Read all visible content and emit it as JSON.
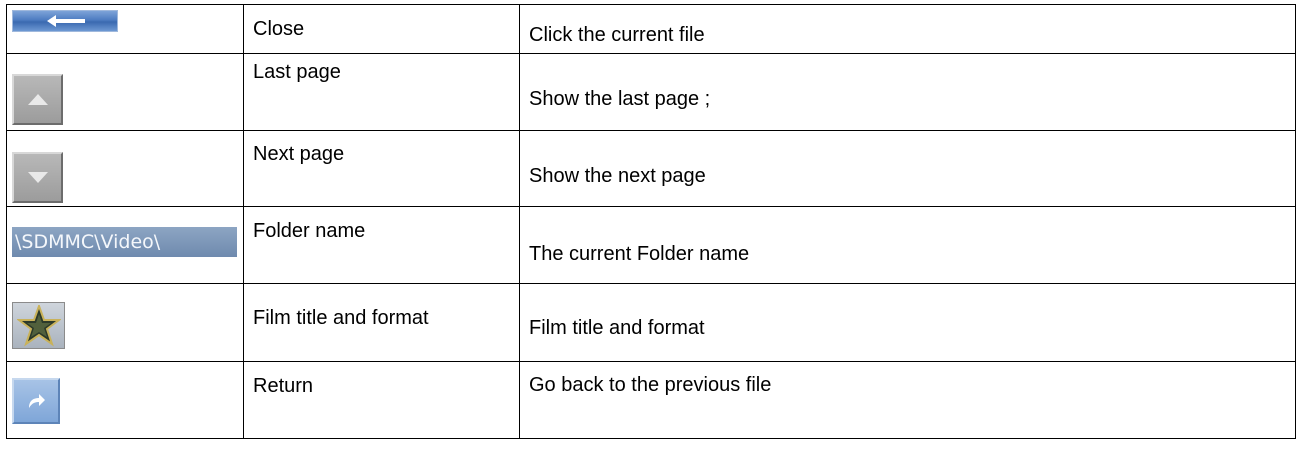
{
  "rows": [
    {
      "icon": "back-arrow-button-icon",
      "name": "Close",
      "description": "Click the current file"
    },
    {
      "icon": "up-arrow-button-icon",
      "name": "Last page",
      "description": "Show the last page ;"
    },
    {
      "icon": "down-arrow-button-icon",
      "name": "Next page",
      "description": "Show the next page"
    },
    {
      "icon": "folder-path-bar",
      "folder_path": "\\SDMMC\\Video\\",
      "name": "Folder name",
      "description": "The current Folder name"
    },
    {
      "icon": "star-film-icon",
      "name": "Film title and format",
      "description": "Film title and format"
    },
    {
      "icon": "return-arrow-button-icon",
      "name": "Return",
      "description": "Go back to the previous file"
    }
  ],
  "colors": {
    "close_button_blue": "#4d7cc1",
    "page_button_gray": "#a8a8a8",
    "folder_bar_blue": "#7d97b8",
    "return_button_blue": "#8fb2de"
  }
}
